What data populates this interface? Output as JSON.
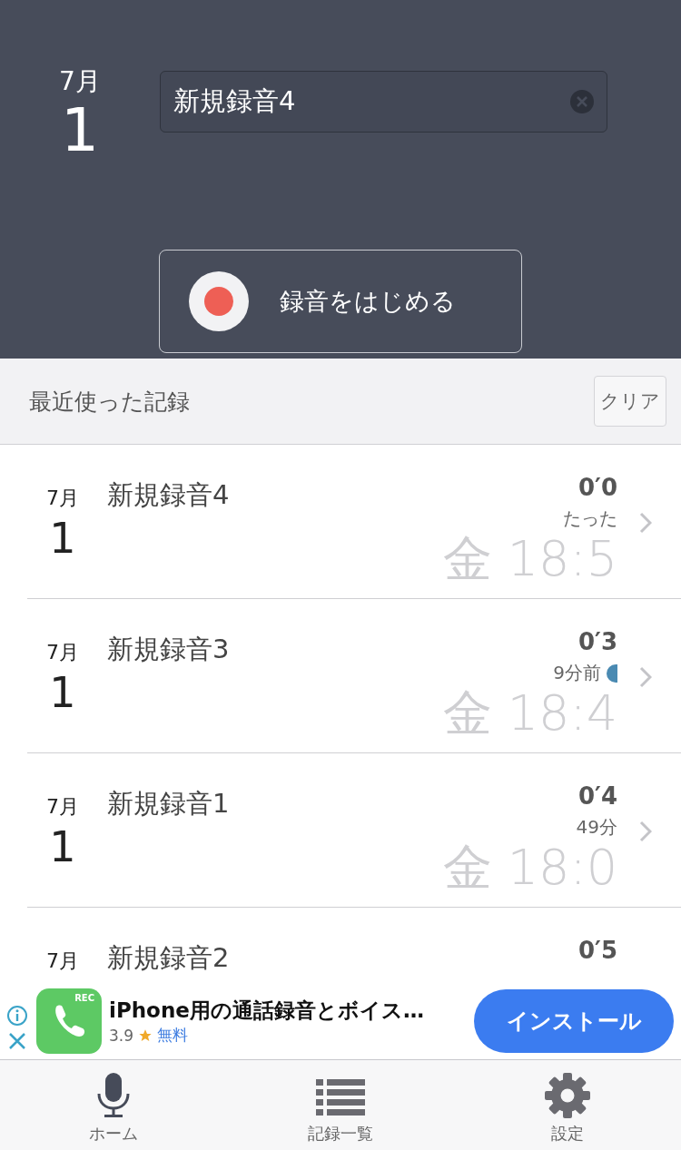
{
  "header": {
    "date": {
      "month": "7月",
      "day": "1"
    },
    "title_field": {
      "value": "新規録音4"
    },
    "record_button": {
      "label": "録音をはじめる"
    }
  },
  "recent": {
    "title": "最近使った記録",
    "clear_button": "クリア"
  },
  "records": [
    {
      "month": "7月",
      "day": "1",
      "title": "新規録音4",
      "duration": "0′0",
      "ago": "たった",
      "time": "金 18:5",
      "new": false
    },
    {
      "month": "7月",
      "day": "1",
      "title": "新規録音3",
      "duration": "0′3",
      "ago": "9分前",
      "time": "金 18:4",
      "new": true
    },
    {
      "month": "7月",
      "day": "1",
      "title": "新規録音1",
      "duration": "0′4",
      "ago": "49分",
      "time": "金 18:0",
      "new": false
    },
    {
      "month": "7月",
      "title": "新規録音2",
      "duration": "0′5",
      "new": false
    }
  ],
  "ad": {
    "title": "iPhone用の通話録音とボイス…",
    "rating": "3.9",
    "price": "無料",
    "button": "インストール",
    "icon_badge": "REC"
  },
  "tabs": [
    {
      "label": "ホーム",
      "kind": "mic",
      "selected": true
    },
    {
      "label": "記録一覧",
      "kind": "list",
      "selected": false
    },
    {
      "label": "設定",
      "kind": "gear",
      "selected": false
    }
  ]
}
